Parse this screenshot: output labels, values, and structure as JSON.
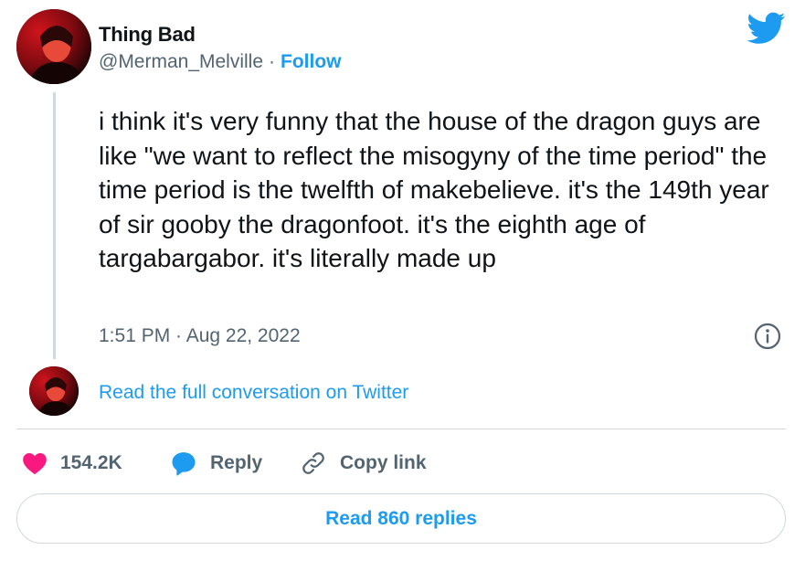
{
  "author": {
    "display_name": "Thing Bad",
    "handle": "@Merman_Melville",
    "separator": "·",
    "follow_label": "Follow",
    "avatar_icon": "avatar-photo"
  },
  "brand": {
    "logo_icon": "twitter-bird-icon",
    "color": "#1d9bf0"
  },
  "tweet": {
    "text": "i think it's very funny that the house of the dragon guys are like \"we want to reflect the misogyny of the time period\" the time period is the twelfth of makebelieve. it's the 149th year of sir gooby the dragonfoot. it's the eighth age of targabargabor. it's literally made up",
    "timestamp": "1:51 PM · Aug 22, 2022"
  },
  "conversation": {
    "read_full_label": "Read the full conversation on Twitter"
  },
  "actions": {
    "like": {
      "count": "154.2K",
      "icon": "heart-icon",
      "color": "#f91880"
    },
    "reply": {
      "label": "Reply",
      "icon": "reply-bubble-icon"
    },
    "copy": {
      "label": "Copy link",
      "icon": "link-icon"
    }
  },
  "footer": {
    "read_replies_label": "Read 860 replies"
  }
}
